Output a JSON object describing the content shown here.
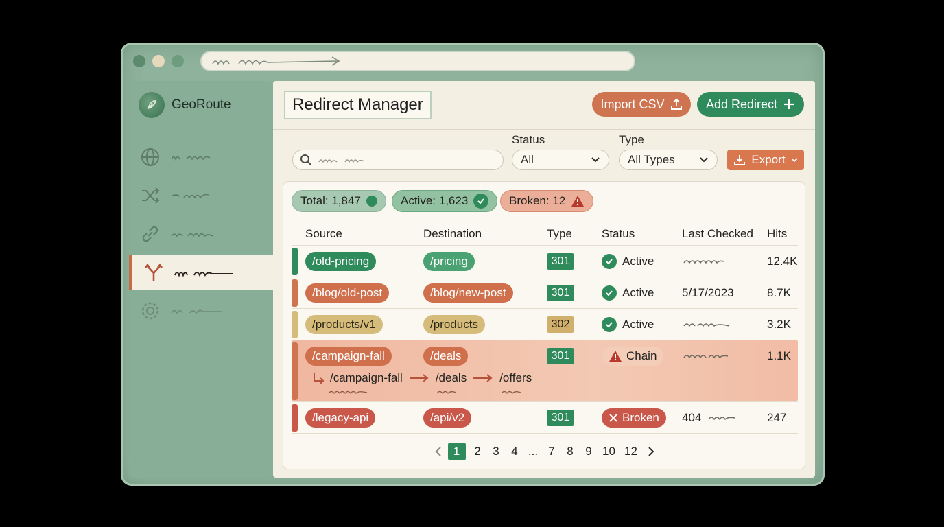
{
  "app": {
    "name": "GeoRoute"
  },
  "header": {
    "title": "Redirect Manager",
    "import_label": "Import CSV",
    "add_label": "Add Redirect"
  },
  "filters": {
    "status_label": "Status",
    "status_value": "All",
    "type_label": "Type",
    "type_value": "All Types",
    "export_label": "Export"
  },
  "stats": {
    "total": "Total: 1,847",
    "active": "Active: 1,623",
    "broken": "Broken: 12"
  },
  "table": {
    "headers": [
      "Source",
      "Destination",
      "Type",
      "Status",
      "Last Checked",
      "Hits"
    ],
    "rows": [
      {
        "source": "/old-pricing",
        "destination": "/pricing",
        "type": "301",
        "status": "Active",
        "last_checked": "",
        "hits": "12.4K"
      },
      {
        "source": "/blog/old-post",
        "destination": "/blog/new-post",
        "type": "301",
        "status": "Active",
        "last_checked": "5/17/2023",
        "hits": "8.7K"
      },
      {
        "source": "/products/v1",
        "destination": "/products",
        "type": "302",
        "status": "Active",
        "last_checked": "",
        "hits": "3.2K"
      },
      {
        "source": "/campaign-fall",
        "destination": "/deals",
        "type": "301",
        "status": "Chain",
        "last_checked": "",
        "hits": "1.1K",
        "chain": [
          "/campaign-fall",
          "/deals",
          "/offers"
        ]
      },
      {
        "source": "/legacy-api",
        "destination": "/api/v2",
        "type": "301",
        "status": "Broken",
        "last_checked": "404",
        "hits": "247"
      }
    ]
  },
  "pagination": {
    "pages": [
      "1",
      "2",
      "3",
      "4",
      "...",
      "7",
      "8",
      "9",
      "10",
      "12"
    ],
    "current": "1"
  },
  "colors": {
    "accent_green": "#2f8a5c",
    "accent_orange": "#cf7450",
    "broken_red": "#c9574a",
    "sidebar": "#89ae97"
  },
  "icons": {
    "nav": [
      "globe-icon",
      "shuffle-icon",
      "link-icon",
      "fork-icon",
      "gear-icon"
    ]
  }
}
